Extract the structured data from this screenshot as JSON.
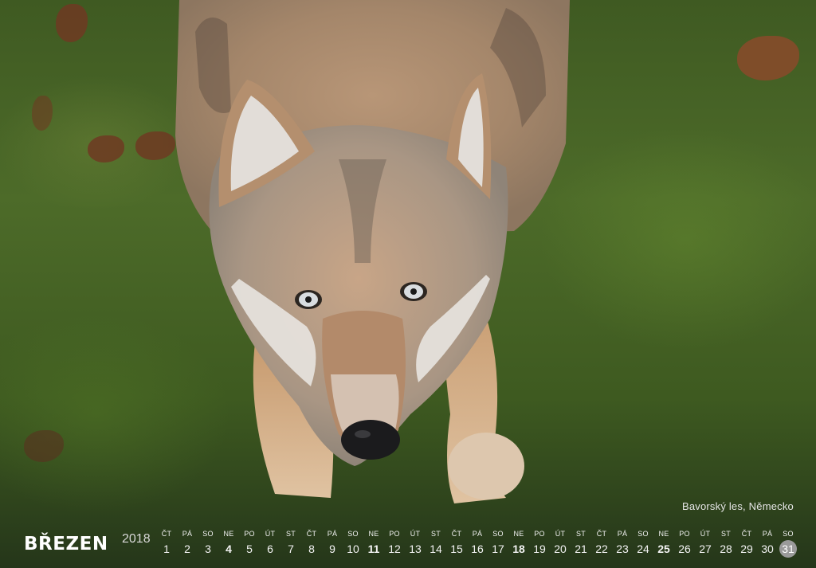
{
  "caption": "Bavorský les, Německo",
  "month": "BŘEZEN",
  "year": "2018",
  "days": [
    {
      "dn": "ČT",
      "dd": "1"
    },
    {
      "dn": "PÁ",
      "dd": "2"
    },
    {
      "dn": "SO",
      "dd": "3"
    },
    {
      "dn": "NE",
      "dd": "4",
      "sun": true
    },
    {
      "dn": "PO",
      "dd": "5"
    },
    {
      "dn": "ÚT",
      "dd": "6"
    },
    {
      "dn": "ST",
      "dd": "7"
    },
    {
      "dn": "ČT",
      "dd": "8"
    },
    {
      "dn": "PÁ",
      "dd": "9"
    },
    {
      "dn": "SO",
      "dd": "10"
    },
    {
      "dn": "NE",
      "dd": "11",
      "sun": true
    },
    {
      "dn": "PO",
      "dd": "12"
    },
    {
      "dn": "ÚT",
      "dd": "13"
    },
    {
      "dn": "ST",
      "dd": "14"
    },
    {
      "dn": "ČT",
      "dd": "15"
    },
    {
      "dn": "PÁ",
      "dd": "16"
    },
    {
      "dn": "SO",
      "dd": "17"
    },
    {
      "dn": "NE",
      "dd": "18",
      "sun": true
    },
    {
      "dn": "PO",
      "dd": "19"
    },
    {
      "dn": "ÚT",
      "dd": "20"
    },
    {
      "dn": "ST",
      "dd": "21"
    },
    {
      "dn": "ČT",
      "dd": "22"
    },
    {
      "dn": "PÁ",
      "dd": "23"
    },
    {
      "dn": "SO",
      "dd": "24"
    },
    {
      "dn": "NE",
      "dd": "25",
      "sun": true
    },
    {
      "dn": "PO",
      "dd": "26"
    },
    {
      "dn": "ÚT",
      "dd": "27"
    },
    {
      "dn": "ST",
      "dd": "28"
    },
    {
      "dn": "ČT",
      "dd": "29"
    },
    {
      "dn": "PÁ",
      "dd": "30"
    },
    {
      "dn": "SO",
      "dd": "31",
      "highlight": true
    }
  ]
}
